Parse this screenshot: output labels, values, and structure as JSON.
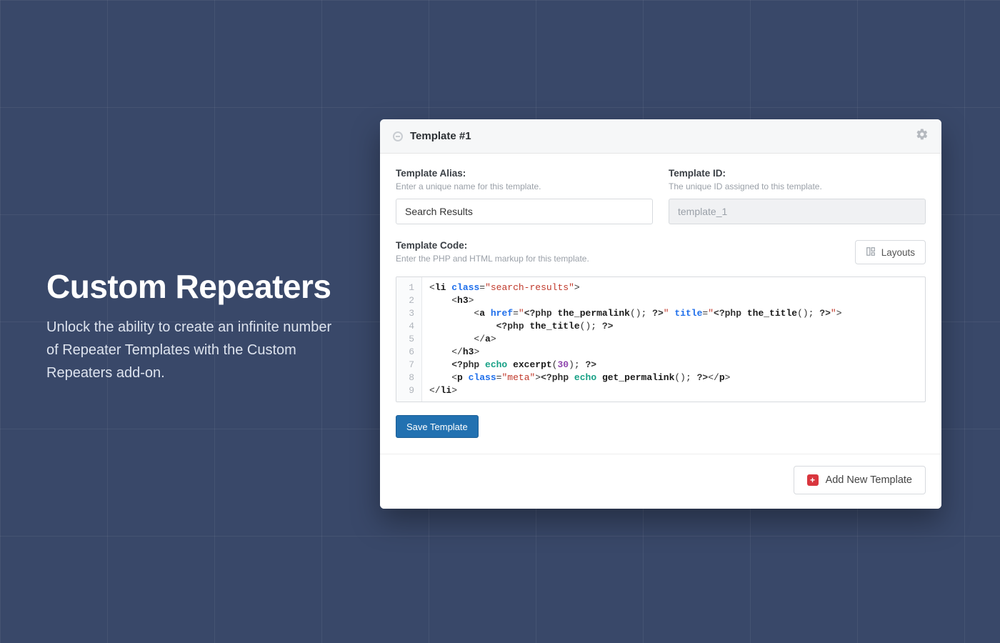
{
  "hero": {
    "title": "Custom Repeaters",
    "subtitle": "Unlock the ability to create an infinite number of Repeater Templates with the Custom Repeaters add-on."
  },
  "panel": {
    "title": "Template #1",
    "alias": {
      "label": "Template Alias:",
      "help": "Enter a unique name for this template.",
      "value": "Search Results"
    },
    "id": {
      "label": "Template ID:",
      "help": "The unique ID assigned to this template.",
      "value": "template_1"
    },
    "code": {
      "label": "Template Code:",
      "help": "Enter the PHP and HTML markup for this template.",
      "layouts_label": "Layouts",
      "line_numbers": [
        "1",
        "2",
        "3",
        "4",
        "5",
        "6",
        "7",
        "8",
        "9"
      ],
      "code_tokens": [
        [
          {
            "t": "tag-angle",
            "v": "<"
          },
          {
            "t": "tag-name",
            "v": "li"
          },
          {
            "t": "plain",
            "v": " "
          },
          {
            "t": "attr-name",
            "v": "class"
          },
          {
            "t": "equals",
            "v": "="
          },
          {
            "t": "string",
            "v": "\"search-results\""
          },
          {
            "t": "tag-angle",
            "v": ">"
          }
        ],
        [
          {
            "t": "plain",
            "v": "    "
          },
          {
            "t": "tag-angle",
            "v": "<"
          },
          {
            "t": "tag-name",
            "v": "h3"
          },
          {
            "t": "tag-angle",
            "v": ">"
          }
        ],
        [
          {
            "t": "plain",
            "v": "        "
          },
          {
            "t": "tag-angle",
            "v": "<"
          },
          {
            "t": "tag-name",
            "v": "a"
          },
          {
            "t": "plain",
            "v": " "
          },
          {
            "t": "attr-name",
            "v": "href"
          },
          {
            "t": "equals",
            "v": "="
          },
          {
            "t": "string",
            "v": "\""
          },
          {
            "t": "php-open",
            "v": "<?php "
          },
          {
            "t": "php-fn",
            "v": "the_permalink"
          },
          {
            "t": "plain",
            "v": "(); "
          },
          {
            "t": "php-open",
            "v": "?>"
          },
          {
            "t": "string",
            "v": "\""
          },
          {
            "t": "plain",
            "v": " "
          },
          {
            "t": "attr-name",
            "v": "title"
          },
          {
            "t": "equals",
            "v": "="
          },
          {
            "t": "string",
            "v": "\""
          },
          {
            "t": "php-open",
            "v": "<?php "
          },
          {
            "t": "php-fn",
            "v": "the_title"
          },
          {
            "t": "plain",
            "v": "(); "
          },
          {
            "t": "php-open",
            "v": "?>"
          },
          {
            "t": "string",
            "v": "\""
          },
          {
            "t": "tag-angle",
            "v": ">"
          }
        ],
        [
          {
            "t": "plain",
            "v": "            "
          },
          {
            "t": "php-open",
            "v": "<?php "
          },
          {
            "t": "php-fn",
            "v": "the_title"
          },
          {
            "t": "plain",
            "v": "(); "
          },
          {
            "t": "php-open",
            "v": "?>"
          }
        ],
        [
          {
            "t": "plain",
            "v": "        "
          },
          {
            "t": "tag-angle",
            "v": "</"
          },
          {
            "t": "tag-name",
            "v": "a"
          },
          {
            "t": "tag-angle",
            "v": ">"
          }
        ],
        [
          {
            "t": "plain",
            "v": "    "
          },
          {
            "t": "tag-angle",
            "v": "</"
          },
          {
            "t": "tag-name",
            "v": "h3"
          },
          {
            "t": "tag-angle",
            "v": ">"
          }
        ],
        [
          {
            "t": "plain",
            "v": "    "
          },
          {
            "t": "php-open",
            "v": "<?php "
          },
          {
            "t": "php-kw",
            "v": "echo"
          },
          {
            "t": "plain",
            "v": " "
          },
          {
            "t": "php-fn",
            "v": "excerpt"
          },
          {
            "t": "plain",
            "v": "("
          },
          {
            "t": "num",
            "v": "30"
          },
          {
            "t": "plain",
            "v": "); "
          },
          {
            "t": "php-open",
            "v": "?>"
          }
        ],
        [
          {
            "t": "plain",
            "v": "    "
          },
          {
            "t": "tag-angle",
            "v": "<"
          },
          {
            "t": "tag-name",
            "v": "p"
          },
          {
            "t": "plain",
            "v": " "
          },
          {
            "t": "attr-name",
            "v": "class"
          },
          {
            "t": "equals",
            "v": "="
          },
          {
            "t": "string",
            "v": "\"meta\""
          },
          {
            "t": "tag-angle",
            "v": ">"
          },
          {
            "t": "php-open",
            "v": "<?php "
          },
          {
            "t": "php-kw",
            "v": "echo"
          },
          {
            "t": "plain",
            "v": " "
          },
          {
            "t": "php-fn",
            "v": "get_permalink"
          },
          {
            "t": "plain",
            "v": "(); "
          },
          {
            "t": "php-open",
            "v": "?>"
          },
          {
            "t": "tag-angle",
            "v": "</"
          },
          {
            "t": "tag-name",
            "v": "p"
          },
          {
            "t": "tag-angle",
            "v": ">"
          }
        ],
        [
          {
            "t": "tag-angle",
            "v": "</"
          },
          {
            "t": "tag-name",
            "v": "li"
          },
          {
            "t": "tag-angle",
            "v": ">"
          }
        ]
      ]
    },
    "save_label": "Save Template",
    "add_label": "Add New Template"
  }
}
